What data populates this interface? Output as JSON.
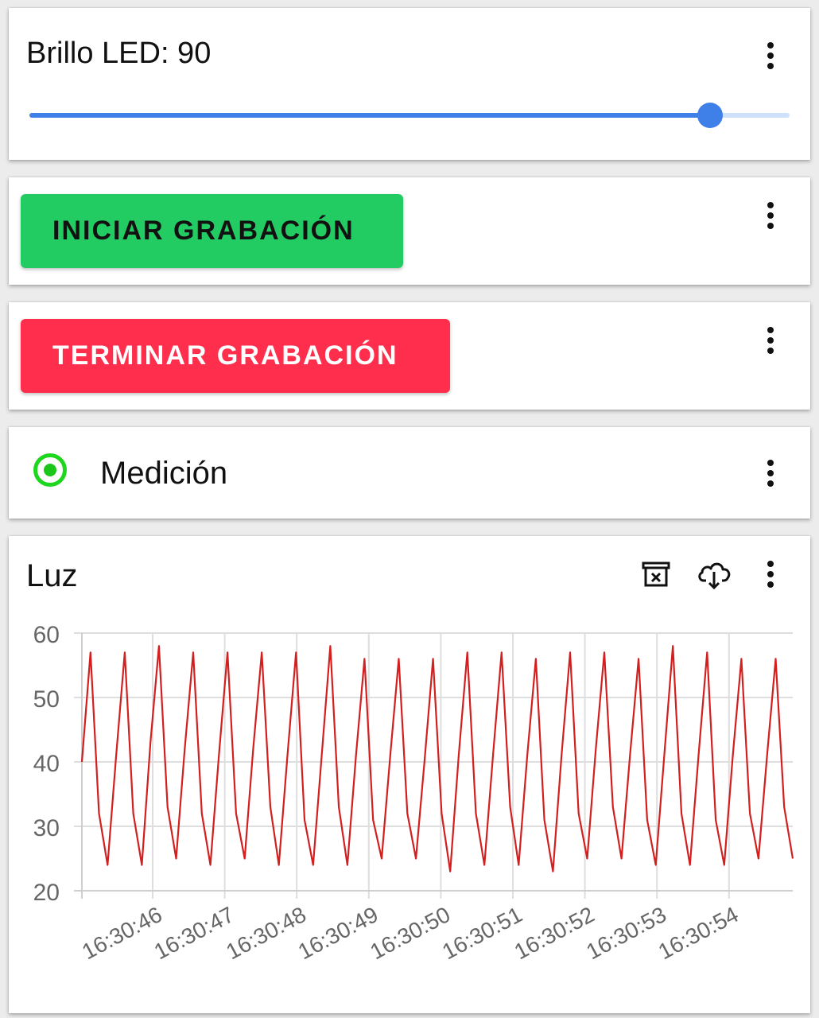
{
  "slider": {
    "label": "Brillo LED: 90",
    "value_fraction": 0.895,
    "color": "#3f80e8"
  },
  "start_button": {
    "label": "INICIAR GRABACIÓN",
    "color": "#22cc62"
  },
  "stop_button": {
    "label": "TERMINAR GRABACIÓN",
    "color": "#ff2e4c"
  },
  "status": {
    "label": "Medición",
    "color": "#1fd61f"
  },
  "chart_card": {
    "title": "Luz",
    "icons": [
      "clear-data-icon",
      "cloud-download-icon",
      "more-vert-icon"
    ]
  },
  "chart_data": {
    "type": "line",
    "title": "Luz",
    "xlabel": "",
    "ylabel": "",
    "ylim": [
      20,
      60
    ],
    "yticks": [
      20,
      30,
      40,
      50,
      60
    ],
    "xticks": [
      "16:30:46",
      "16:30:47",
      "16:30:48",
      "16:30:49",
      "16:30:50",
      "16:30:51",
      "16:30:52",
      "16:30:53",
      "16:30:54"
    ],
    "grid": true,
    "series": [
      {
        "color": "#d21f1f",
        "values": [
          40,
          57,
          32,
          24,
          41,
          57,
          32,
          24,
          43,
          58,
          33,
          25,
          42,
          57,
          32,
          24,
          41,
          57,
          32,
          25,
          42,
          57,
          33,
          24,
          41,
          57,
          31,
          24,
          41,
          58,
          33,
          24,
          41,
          56,
          31,
          25,
          41,
          56,
          32,
          25,
          40,
          56,
          32,
          23,
          41,
          57,
          32,
          24,
          41,
          57,
          33,
          24,
          41,
          56,
          31,
          23,
          41,
          57,
          32,
          25,
          42,
          57,
          33,
          25,
          41,
          56,
          31,
          24,
          41,
          58,
          32,
          24,
          41,
          57,
          31,
          24,
          41,
          56,
          32,
          25,
          41,
          56,
          33,
          25
        ]
      }
    ]
  }
}
